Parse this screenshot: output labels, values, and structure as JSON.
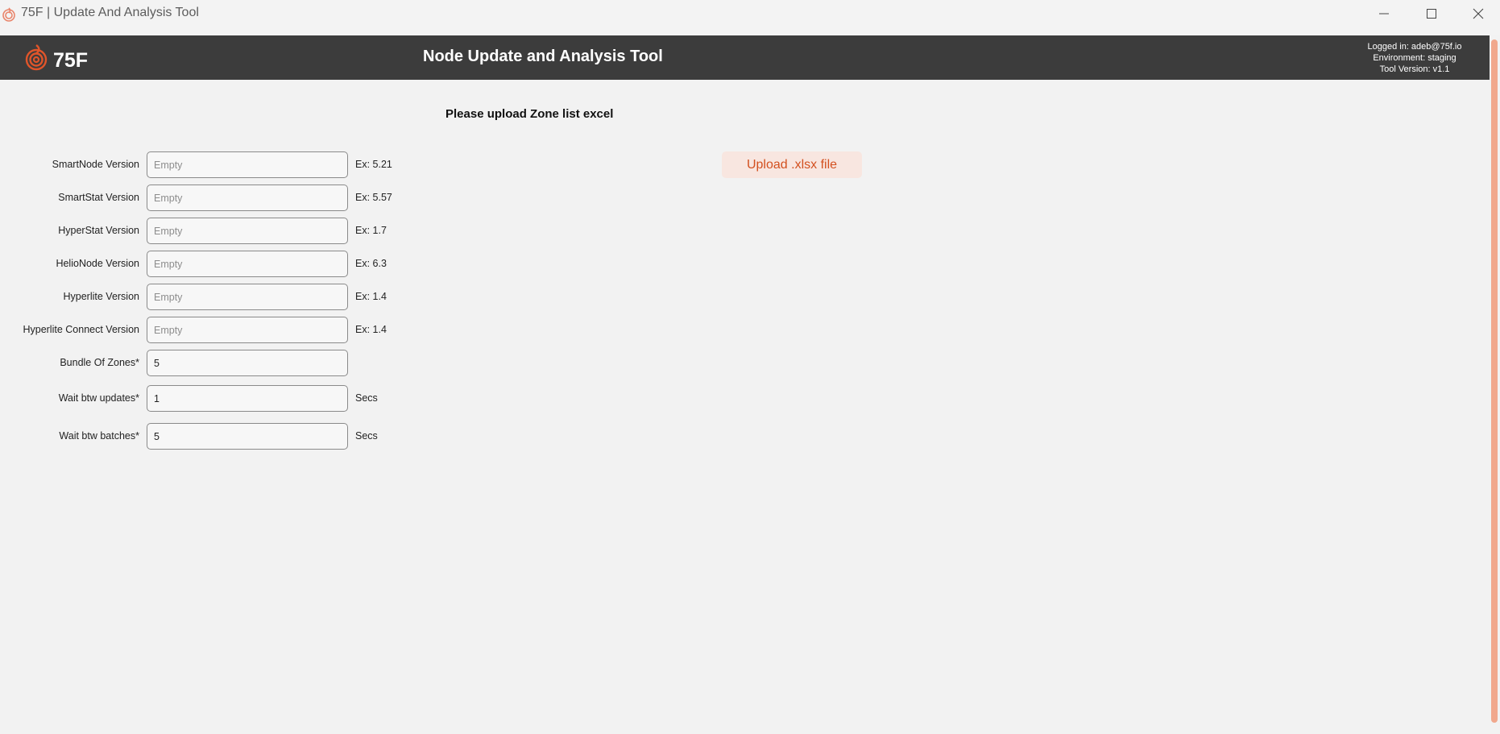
{
  "window": {
    "title": "75F | Update And Analysis Tool",
    "controls": [
      "minimize-icon",
      "maximize-icon",
      "close-icon"
    ]
  },
  "header": {
    "logo_text": "75F",
    "title": "Node Update and Analysis Tool",
    "logged_in": "Logged in: adeb@75f.io",
    "environment": "Environment: staging",
    "tool_version": "Tool Version: v1.1"
  },
  "upload": {
    "heading": "Please upload Zone list excel",
    "button_label": "Upload .xlsx file"
  },
  "form": {
    "fields": [
      {
        "label": "SmartNode Version",
        "value": "",
        "placeholder": "Empty",
        "hint": "Ex: 5.21"
      },
      {
        "label": "SmartStat Version",
        "value": "",
        "placeholder": "Empty",
        "hint": "Ex: 5.57"
      },
      {
        "label": "HyperStat Version",
        "value": "",
        "placeholder": "Empty",
        "hint": "Ex: 1.7"
      },
      {
        "label": "HelioNode Version",
        "value": "",
        "placeholder": "Empty",
        "hint": "Ex: 6.3"
      },
      {
        "label": "Hyperlite Version",
        "value": "",
        "placeholder": "Empty",
        "hint": "Ex: 1.4"
      },
      {
        "label": "Hyperlite Connect Version",
        "value": "",
        "placeholder": "Empty",
        "hint": "Ex: 1.4"
      },
      {
        "label": "Bundle Of Zones*",
        "value": "5",
        "placeholder": "",
        "hint": ""
      },
      {
        "label": "Wait btw updates*",
        "value": "1",
        "placeholder": "",
        "hint": "Secs"
      },
      {
        "label": "Wait btw batches*",
        "value": "5",
        "placeholder": "",
        "hint": "Secs"
      }
    ]
  },
  "colors": {
    "header_bg": "#3c3c3c",
    "accent": "#d3501f",
    "upload_button_bg": "#f8e6e0",
    "scrollbar_thumb": "#f1a88d",
    "page_bg": "#f2f2f2"
  }
}
